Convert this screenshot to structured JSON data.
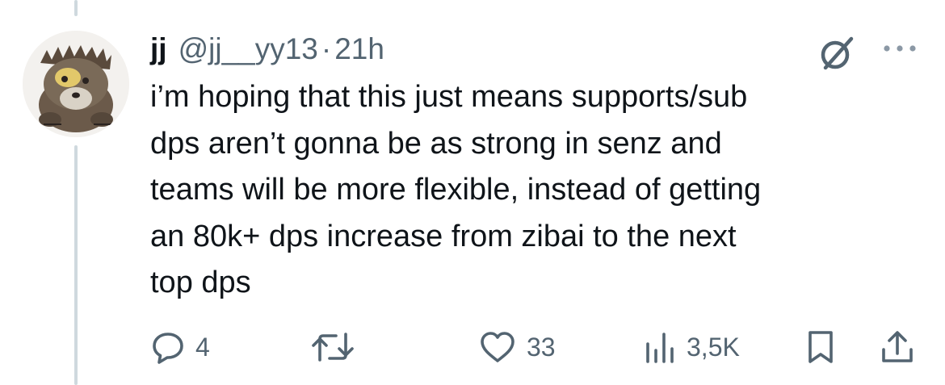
{
  "tweet": {
    "display_name": "jj",
    "handle": "@jj__yy13",
    "separator": "·",
    "timestamp": "21h",
    "text_lines": [
      "i’m hoping that this just means supports/sub",
      "dps aren’t gonna be as strong in senz and",
      "teams will be more flexible, instead of getting",
      "an 80k+ dps increase from zibai to the next",
      "top dps"
    ]
  },
  "actions": {
    "reply_count": "4",
    "like_count": "33",
    "views_count": "3,5K"
  },
  "icons": {
    "reply": "reply-bubble-icon",
    "retweet": "retweet-icon",
    "like": "heart-icon",
    "views": "views-bars-icon",
    "bookmark": "bookmark-icon",
    "share": "share-upload-icon",
    "grok": "grok-slash-icon",
    "more": "more-dots-icon"
  },
  "colors": {
    "text_primary": "#0f1419",
    "text_secondary": "#536471",
    "thread_line": "#cfd9de"
  }
}
